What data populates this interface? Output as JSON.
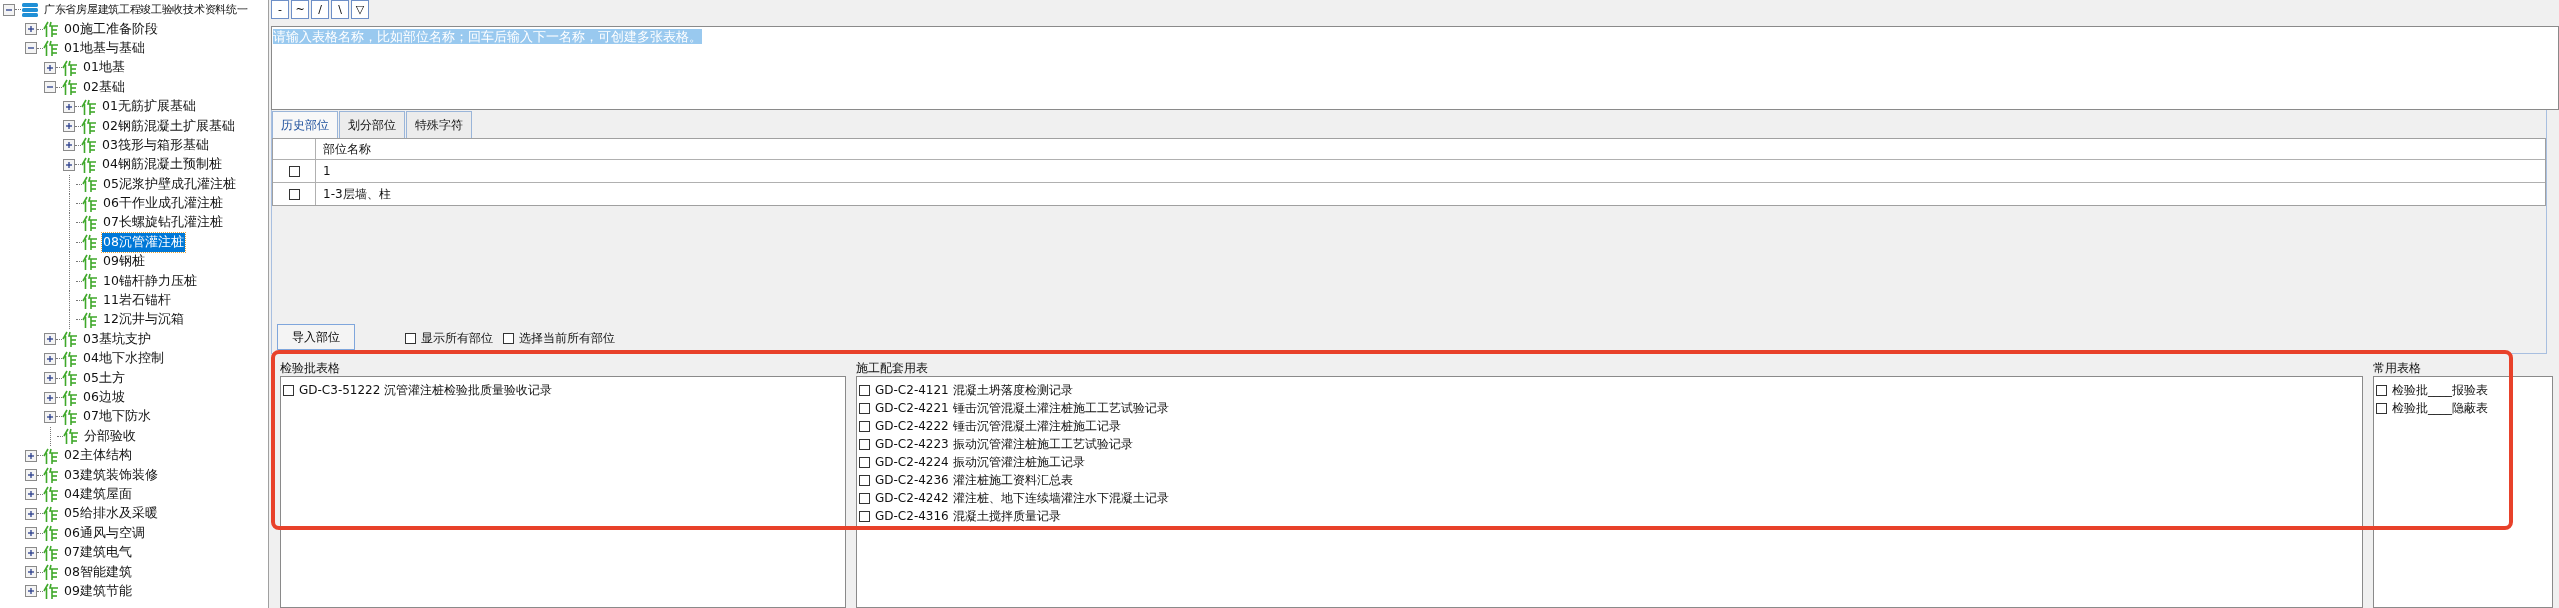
{
  "tree": {
    "label": "广东省房屋建筑工程竣工验收技术资料统一",
    "kind": "root",
    "expanded": true,
    "selected": false,
    "children": [
      {
        "label": "00施工准备阶段",
        "kind": "branch",
        "expanded": false,
        "selected": false
      },
      {
        "label": "01地基与基础",
        "kind": "branch",
        "expanded": true,
        "selected": false,
        "children": [
          {
            "label": "01地基",
            "kind": "branch",
            "expanded": false,
            "selected": false
          },
          {
            "label": "02基础",
            "kind": "branch",
            "expanded": true,
            "selected": false,
            "children": [
              {
                "label": "01无筋扩展基础",
                "kind": "branch",
                "expanded": false,
                "selected": false
              },
              {
                "label": "02钢筋混凝土扩展基础",
                "kind": "branch",
                "expanded": false,
                "selected": false
              },
              {
                "label": "03筏形与箱形基础",
                "kind": "branch",
                "expanded": false,
                "selected": false
              },
              {
                "label": "04钢筋混凝土预制桩",
                "kind": "branch",
                "expanded": false,
                "selected": false
              },
              {
                "label": "05泥浆护壁成孔灌注桩",
                "kind": "leaf",
                "selected": false
              },
              {
                "label": "06干作业成孔灌注桩",
                "kind": "leaf",
                "selected": false
              },
              {
                "label": "07长螺旋钻孔灌注桩",
                "kind": "leaf",
                "selected": false
              },
              {
                "label": "08沉管灌注桩",
                "kind": "leaf",
                "selected": true
              },
              {
                "label": "09钢桩",
                "kind": "leaf",
                "selected": false
              },
              {
                "label": "10锚杆静力压桩",
                "kind": "leaf",
                "selected": false
              },
              {
                "label": "11岩石锚杆",
                "kind": "leaf",
                "selected": false
              },
              {
                "label": "12沉井与沉箱",
                "kind": "leaf",
                "selected": false
              }
            ]
          },
          {
            "label": "03基坑支护",
            "kind": "branch",
            "expanded": false,
            "selected": false
          },
          {
            "label": "04地下水控制",
            "kind": "branch",
            "expanded": false,
            "selected": false
          },
          {
            "label": "05土方",
            "kind": "branch",
            "expanded": false,
            "selected": false
          },
          {
            "label": "06边坡",
            "kind": "branch",
            "expanded": false,
            "selected": false
          },
          {
            "label": "07地下防水",
            "kind": "branch",
            "expanded": false,
            "selected": false
          },
          {
            "label": "分部验收",
            "kind": "leaf",
            "selected": false
          }
        ]
      },
      {
        "label": "02主体结构",
        "kind": "branch",
        "expanded": false,
        "selected": false
      },
      {
        "label": "03建筑装饰装修",
        "kind": "branch",
        "expanded": false,
        "selected": false
      },
      {
        "label": "04建筑屋面",
        "kind": "branch",
        "expanded": false,
        "selected": false
      },
      {
        "label": "05给排水及采暖",
        "kind": "branch",
        "expanded": false,
        "selected": false
      },
      {
        "label": "06通风与空调",
        "kind": "branch",
        "expanded": false,
        "selected": false
      },
      {
        "label": "07建筑电气",
        "kind": "branch",
        "expanded": false,
        "selected": false
      },
      {
        "label": "08智能建筑",
        "kind": "branch",
        "expanded": false,
        "selected": false
      },
      {
        "label": "09建筑节能",
        "kind": "branch",
        "expanded": false,
        "selected": false
      }
    ]
  },
  "toolbar": [
    "-",
    "~",
    "/",
    "\\",
    "▽"
  ],
  "name_input": {
    "value": "请输入表格名称，比如部位名称；回车后输入下一名称，可创建多张表格。",
    "text_selected": true
  },
  "tabs": [
    {
      "label": "历史部位",
      "selected": true
    },
    {
      "label": "划分部位",
      "selected": false
    },
    {
      "label": "特殊字符",
      "selected": false
    }
  ],
  "table": {
    "columns": [
      "部位名称"
    ],
    "rows": [
      {
        "checked": false,
        "name": "1"
      },
      {
        "checked": false,
        "name": "1-3层墙、柱"
      }
    ]
  },
  "import_button": "导入部位",
  "options": [
    {
      "label": "显示所有部位",
      "checked": false
    },
    {
      "label": "选择当前所有部位",
      "checked": false
    }
  ],
  "groups": [
    {
      "title": "检验批表格",
      "items": [
        {
          "label": "GD-C3-51222 沉管灌注桩检验批质量验收记录",
          "checked": false
        }
      ]
    },
    {
      "title": "施工配套用表",
      "items": [
        {
          "label": "GD-C2-4121 混凝土坍落度检测记录",
          "checked": false
        },
        {
          "label": "GD-C2-4221 锤击沉管混凝土灌注桩施工工艺试验记录",
          "checked": false
        },
        {
          "label": "GD-C2-4222 锤击沉管混凝土灌注桩施工记录",
          "checked": false
        },
        {
          "label": "GD-C2-4223 振动沉管灌注桩施工工艺试验记录",
          "checked": false
        },
        {
          "label": "GD-C2-4224 振动沉管灌注桩施工记录",
          "checked": false
        },
        {
          "label": "GD-C2-4236 灌注桩施工资料汇总表",
          "checked": false
        },
        {
          "label": "GD-C2-4242 灌注桩、地下连续墙灌注水下混凝土记录",
          "checked": false
        },
        {
          "label": "GD-C2-4316 混凝土搅拌质量记录",
          "checked": false
        }
      ]
    },
    {
      "title": "常用表格",
      "items": [
        {
          "label": "检验批____报验表",
          "checked": false
        },
        {
          "label": "检验批____隐蔽表",
          "checked": false
        }
      ]
    }
  ]
}
